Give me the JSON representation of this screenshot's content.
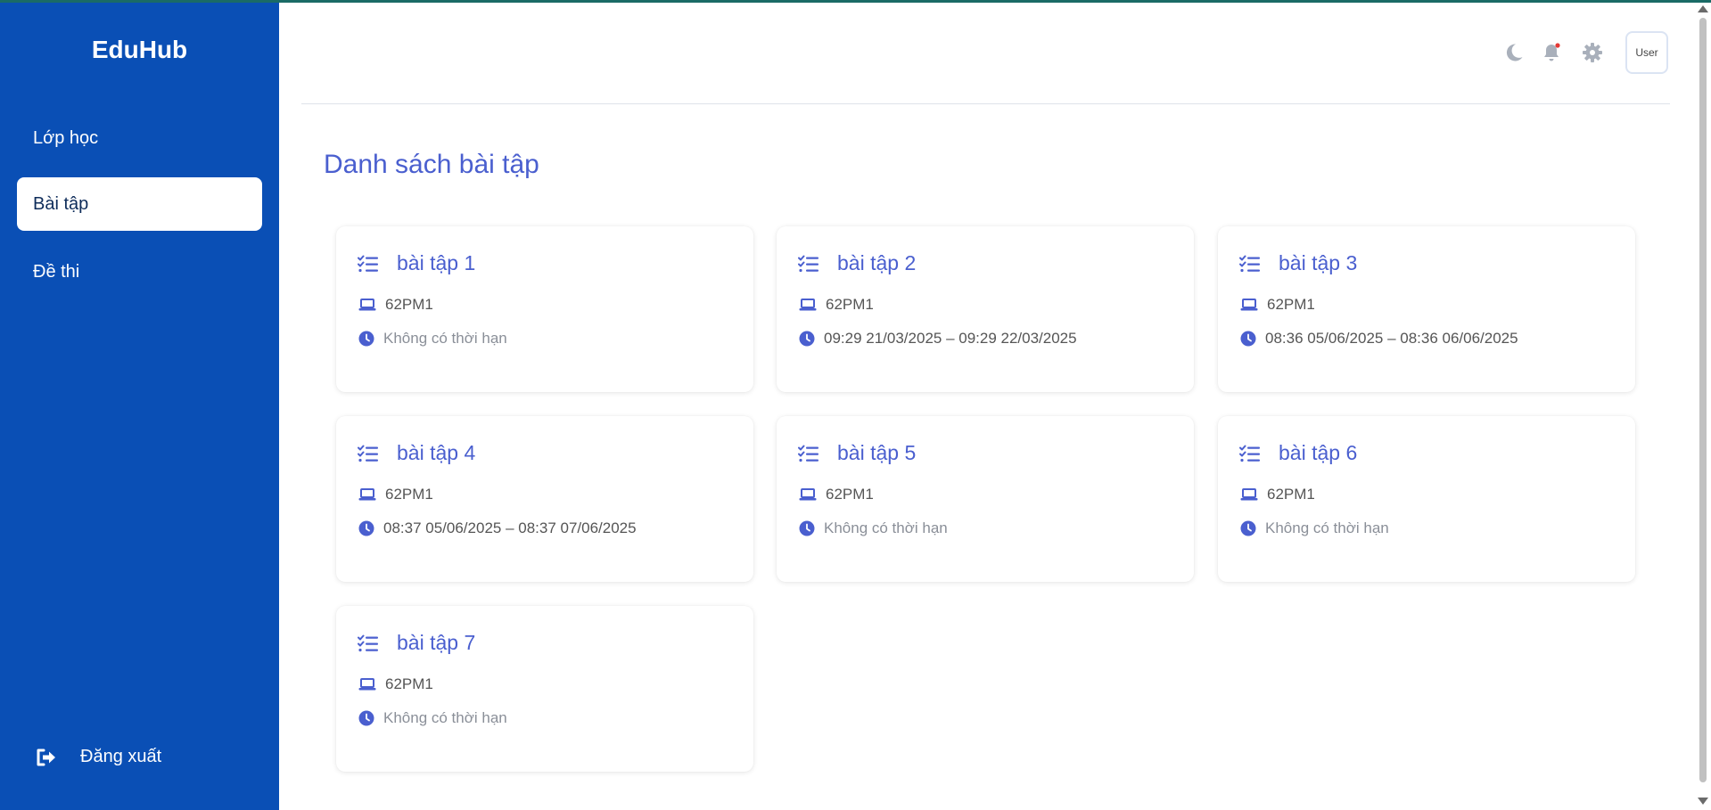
{
  "app": {
    "title": "EduHub"
  },
  "sidebar": {
    "items": [
      {
        "label": "Lớp học",
        "active": false
      },
      {
        "label": "Bài tập",
        "active": true
      },
      {
        "label": "Đề thi",
        "active": false
      }
    ],
    "logout_label": "Đăng xuất"
  },
  "header": {
    "icons": [
      "moon-icon",
      "bell-icon",
      "gear-icon"
    ],
    "has_notification_dot": true,
    "user_label": "User"
  },
  "page": {
    "title": "Danh sách bài tập"
  },
  "assignments": [
    {
      "title": "bài tập 1",
      "class": "62PM1",
      "deadline": "Không có thời hạn",
      "has_deadline": false
    },
    {
      "title": "bài tập 2",
      "class": "62PM1",
      "deadline": "09:29 21/03/2025 – 09:29 22/03/2025",
      "has_deadline": true
    },
    {
      "title": "bài tập 3",
      "class": "62PM1",
      "deadline": "08:36 05/06/2025 – 08:36 06/06/2025",
      "has_deadline": true
    },
    {
      "title": "bài tập 4",
      "class": "62PM1",
      "deadline": "08:37 05/06/2025 – 08:37 07/06/2025",
      "has_deadline": true
    },
    {
      "title": "bài tập 5",
      "class": "62PM1",
      "deadline": "Không có thời hạn",
      "has_deadline": false
    },
    {
      "title": "bài tập 6",
      "class": "62PM1",
      "deadline": "Không có thời hạn",
      "has_deadline": false
    },
    {
      "title": "bài tập 7",
      "class": "62PM1",
      "deadline": "Không có thời hạn",
      "has_deadline": false
    }
  ],
  "colors": {
    "sidebar_bg": "#0a4fb5",
    "accent": "#4a5fcf",
    "notification_dot": "#e53935"
  }
}
